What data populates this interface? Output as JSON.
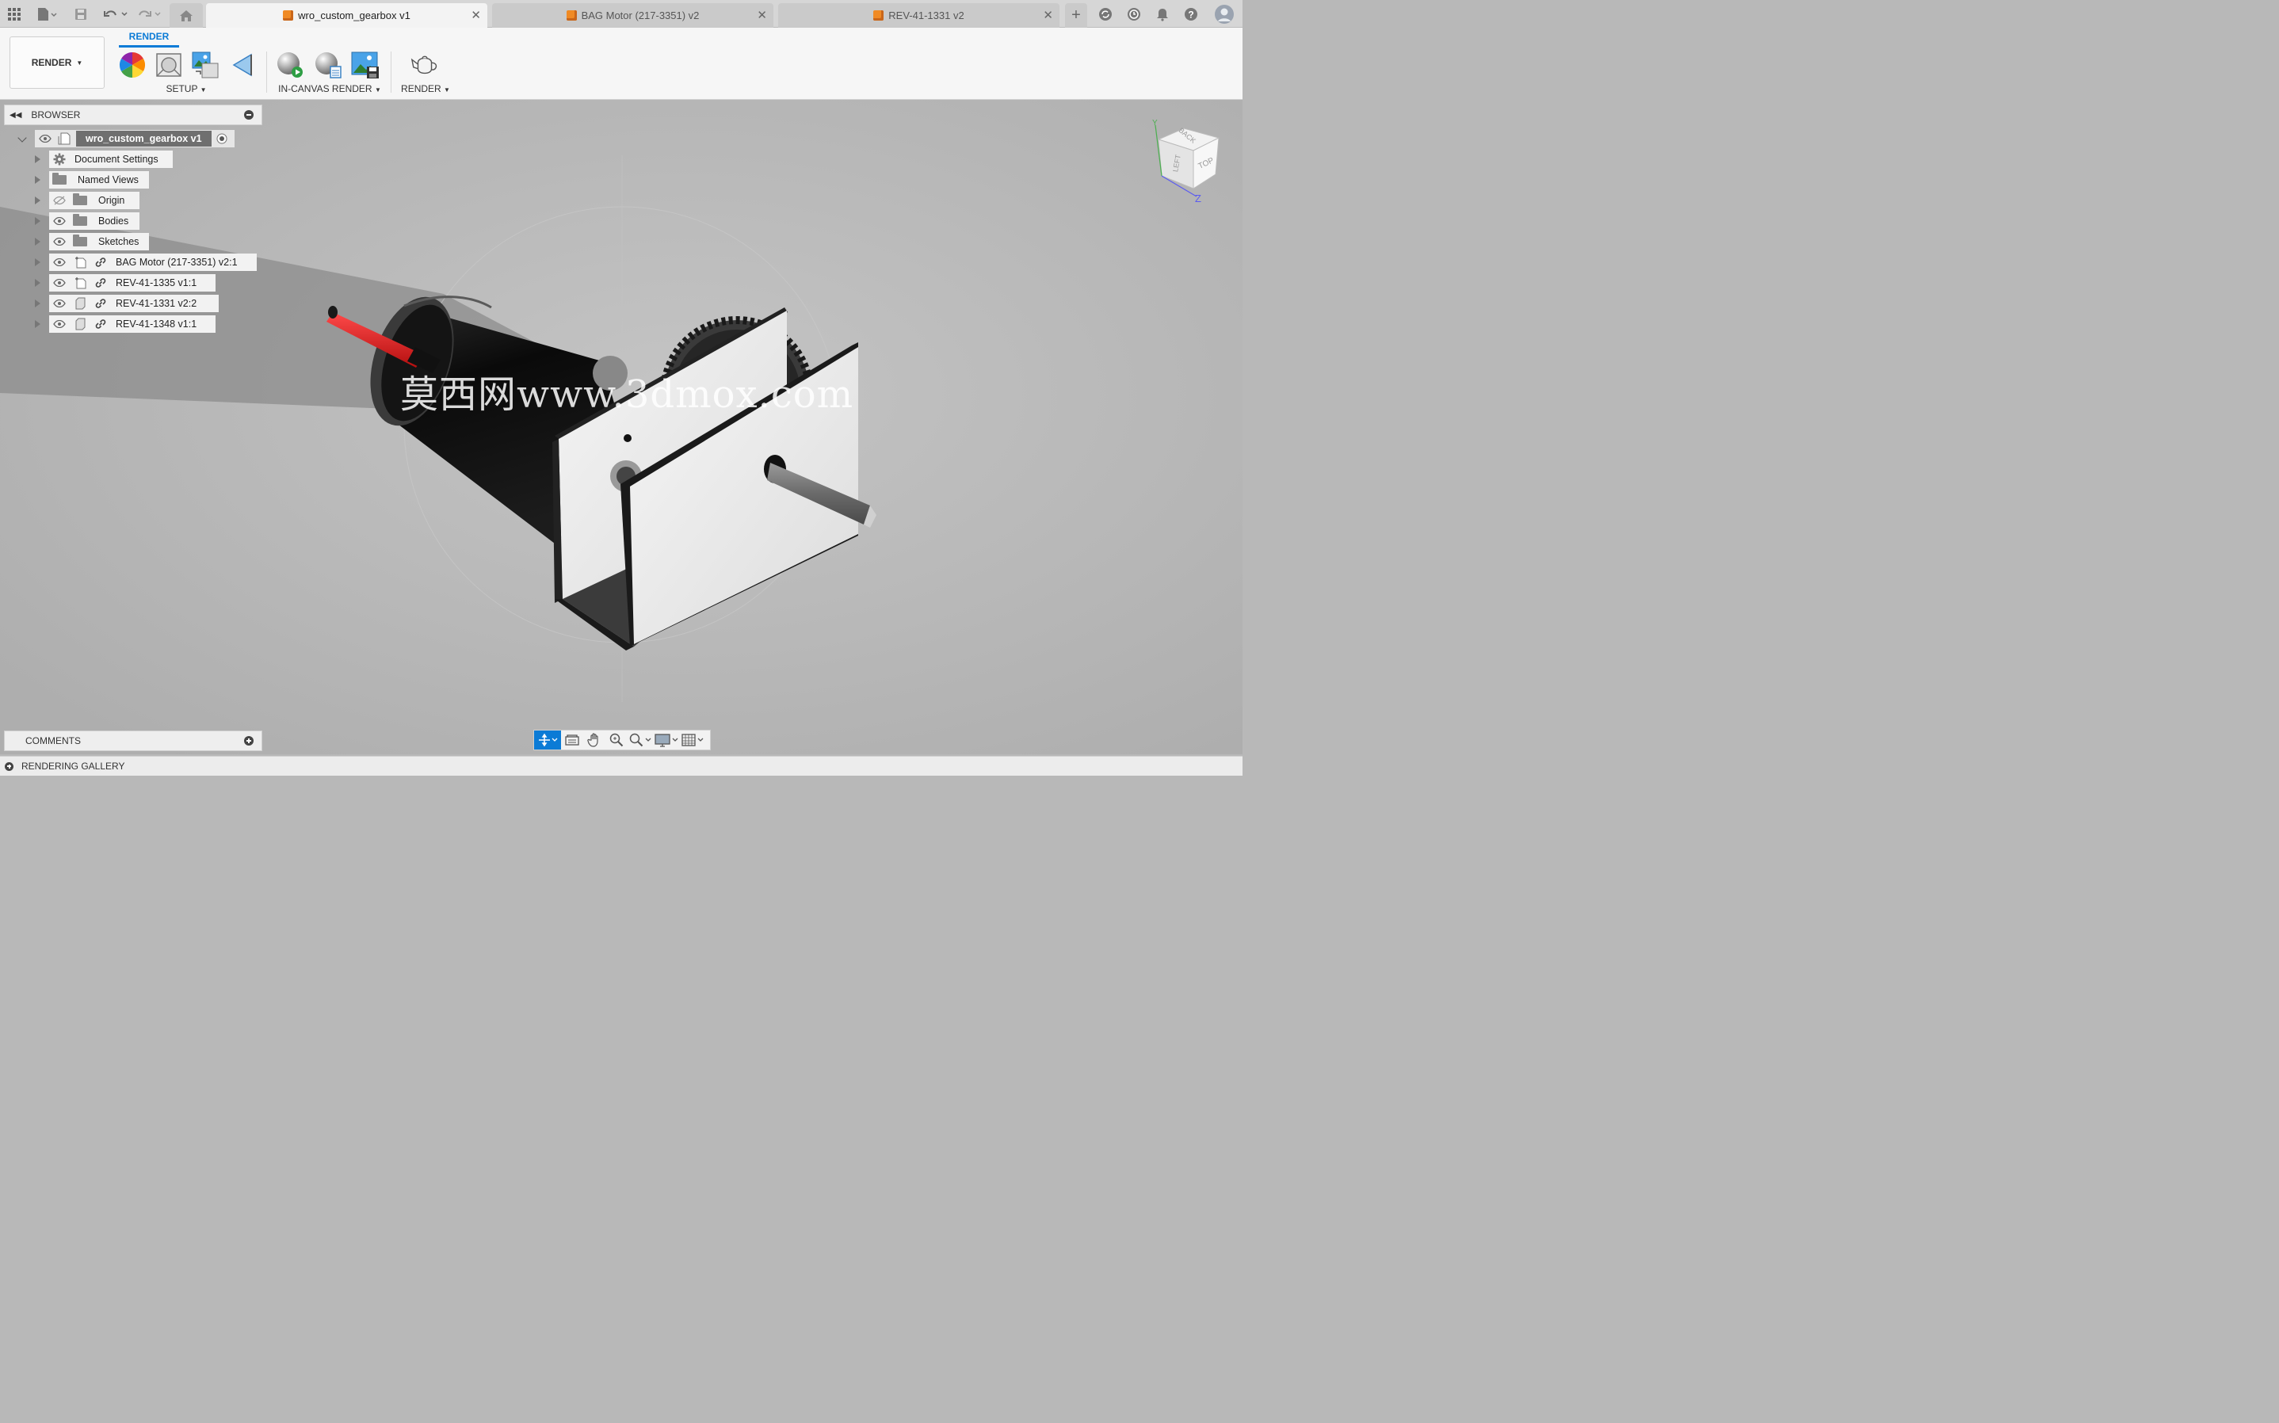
{
  "tabs": [
    {
      "label": "wro_custom_gearbox v1",
      "active": true
    },
    {
      "label": "BAG Motor (217-3351) v2",
      "active": false
    },
    {
      "label": "REV-41-1331 v2",
      "active": false
    }
  ],
  "toolbar": {
    "workspace_label": "RENDER",
    "ribbon_tab": "RENDER",
    "groups": {
      "setup": "SETUP",
      "in_canvas": "IN-CANVAS RENDER",
      "render": "RENDER"
    }
  },
  "browser": {
    "title": "BROWSER",
    "root": "wro_custom_gearbox v1",
    "items": [
      {
        "label": "Document Settings",
        "type": "settings"
      },
      {
        "label": "Named Views",
        "type": "folder"
      },
      {
        "label": "Origin",
        "type": "folder",
        "hidden": true
      },
      {
        "label": "Bodies",
        "type": "folder"
      },
      {
        "label": "Sketches",
        "type": "folder"
      },
      {
        "label": "BAG Motor (217-3351) v2:1",
        "type": "component"
      },
      {
        "label": "REV-41-1335 v1:1",
        "type": "component"
      },
      {
        "label": "REV-41-1331 v2:2",
        "type": "component"
      },
      {
        "label": "REV-41-1348 v1:1",
        "type": "component"
      }
    ]
  },
  "viewcube": {
    "faces": [
      "BACK",
      "LEFT",
      "TOP"
    ],
    "axes": [
      "Y",
      "Z"
    ]
  },
  "watermark": "莫西网www.3dmox.com",
  "comments_label": "COMMENTS",
  "gallery_label": "RENDERING GALLERY"
}
